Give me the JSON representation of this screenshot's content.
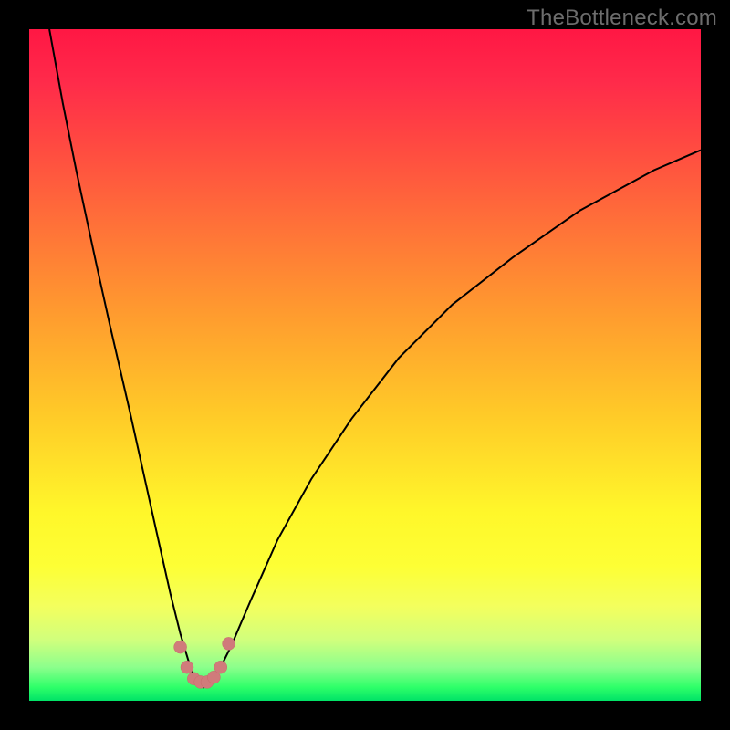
{
  "watermark": "TheBottleneck.com",
  "chart_data": {
    "type": "line",
    "title": "",
    "xlabel": "",
    "ylabel": "",
    "xlim": [
      0,
      100
    ],
    "ylim": [
      0,
      100
    ],
    "series": [
      {
        "name": "bottleneck-curve",
        "x": [
          3,
          5,
          7,
          10,
          12,
          15,
          17,
          19,
          21,
          22.5,
          24,
          25,
          26,
          27,
          28,
          30,
          33,
          37,
          42,
          48,
          55,
          63,
          72,
          82,
          93,
          100
        ],
        "y": [
          100,
          89,
          79,
          65,
          56,
          43,
          34,
          25,
          16,
          10,
          5,
          2.5,
          2,
          2.5,
          4,
          8,
          15,
          24,
          33,
          42,
          51,
          59,
          66,
          73,
          79,
          82
        ]
      }
    ],
    "markers": {
      "name": "highlight-dots",
      "points": [
        {
          "x": 22.5,
          "y": 8
        },
        {
          "x": 23.5,
          "y": 5
        },
        {
          "x": 24.5,
          "y": 3.3
        },
        {
          "x": 25.5,
          "y": 2.8
        },
        {
          "x": 26.5,
          "y": 2.8
        },
        {
          "x": 27.5,
          "y": 3.5
        },
        {
          "x": 28.5,
          "y": 5
        },
        {
          "x": 29.7,
          "y": 8.5
        }
      ]
    }
  }
}
